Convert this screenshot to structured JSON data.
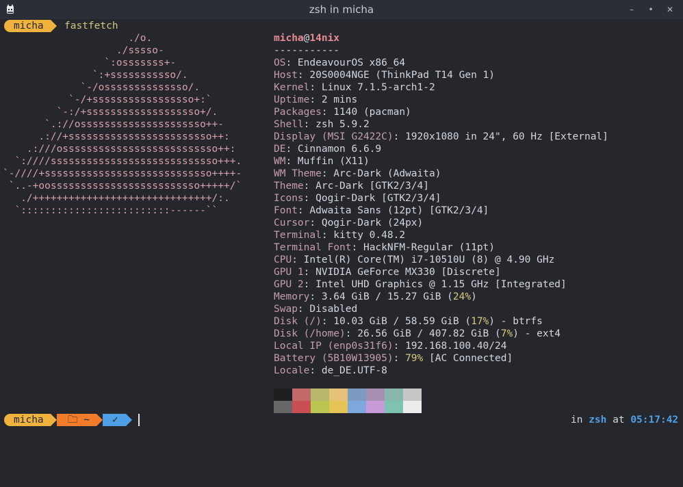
{
  "window": {
    "title": "zsh in micha",
    "minimize": "–",
    "maximize": "•",
    "close": "✕"
  },
  "prompt1": {
    "user": "micha",
    "command": "fastfetch"
  },
  "logo_lines": [
    "                     ./o.",
    "                   ./sssso-",
    "                 `:osssssss+-",
    "               `:+sssssssssso/.",
    "             `-/ossssssssssssso/.",
    "           `-/+sssssssssssssssso+:`",
    "         `-:/+sssssssssssssssssso+/.",
    "       `.://osssssssssssssssssssso++-",
    "      .://+ssssssssssssssssssssssso++:",
    "    .:///ossssssssssssssssssssssssso++:",
    "  `:////ssssssssssssssssssssssssssso+++.",
    "`-////+ssssssssssssssssssssssssssso++++-",
    " `..-+oosssssssssssssssssssssssso+++++/`",
    "   ./++++++++++++++++++++++++++++++/:.",
    "  `:::::::::::::::::::::::::------``"
  ],
  "header": {
    "user": "micha",
    "at": "@",
    "host": "14nix",
    "separator": "-----------"
  },
  "info": [
    {
      "label": "OS",
      "parts": [
        {
          "t": ": EndeavourOS x86_64"
        }
      ]
    },
    {
      "label": "Host",
      "parts": [
        {
          "t": ": 20S0004NGE (ThinkPad T14 Gen 1)"
        }
      ]
    },
    {
      "label": "Kernel",
      "parts": [
        {
          "t": ": Linux 7.1.5-arch1-2"
        }
      ]
    },
    {
      "label": "Uptime",
      "parts": [
        {
          "t": ": 2 mins"
        }
      ]
    },
    {
      "label": "Packages",
      "parts": [
        {
          "t": ": 1140 (pacman)"
        }
      ]
    },
    {
      "label": "Shell",
      "parts": [
        {
          "t": ": zsh 5.9.2"
        }
      ]
    },
    {
      "label": "Display (MSI G2422C)",
      "parts": [
        {
          "t": ": 1920x1080 in 24\", 60 Hz [External]"
        }
      ]
    },
    {
      "label": "DE",
      "parts": [
        {
          "t": ": Cinnamon 6.6.9"
        }
      ]
    },
    {
      "label": "WM",
      "parts": [
        {
          "t": ": Muffin (X11)"
        }
      ]
    },
    {
      "label": "WM Theme",
      "parts": [
        {
          "t": ": Arc-Dark (Adwaita)"
        }
      ]
    },
    {
      "label": "Theme",
      "parts": [
        {
          "t": ": Arc-Dark [GTK2/3/4]"
        }
      ]
    },
    {
      "label": "Icons",
      "parts": [
        {
          "t": ": Qogir-Dark [GTK2/3/4]"
        }
      ]
    },
    {
      "label": "Font",
      "parts": [
        {
          "t": ": Adwaita Sans (12pt) [GTK2/3/4]"
        }
      ]
    },
    {
      "label": "Cursor",
      "parts": [
        {
          "t": ": Qogir-Dark (24px)"
        }
      ]
    },
    {
      "label": "Terminal",
      "parts": [
        {
          "t": ": kitty 0.48.2"
        }
      ]
    },
    {
      "label": "Terminal Font",
      "parts": [
        {
          "t": ": HackNFM-Regular (11pt)"
        }
      ]
    },
    {
      "label": "CPU",
      "parts": [
        {
          "t": ": Intel(R) Core(TM) i7-10510U (8) @ 4.90 GHz"
        }
      ]
    },
    {
      "label": "GPU 1",
      "parts": [
        {
          "t": ": NVIDIA GeForce MX330 [Discrete]"
        }
      ]
    },
    {
      "label": "GPU 2",
      "parts": [
        {
          "t": ": Intel UHD Graphics @ 1.15 GHz [Integrated]"
        }
      ]
    },
    {
      "label": "Memory",
      "parts": [
        {
          "t": ": 3.64 GiB / 15.27 GiB ("
        },
        {
          "t": "24%",
          "pct": true
        },
        {
          "t": ")"
        }
      ]
    },
    {
      "label": "Swap",
      "parts": [
        {
          "t": ": Disabled"
        }
      ]
    },
    {
      "label": "Disk (/)",
      "parts": [
        {
          "t": ": 10.03 GiB / 58.59 GiB ("
        },
        {
          "t": "17%",
          "pct": true
        },
        {
          "t": ") - btrfs"
        }
      ]
    },
    {
      "label": "Disk (/home)",
      "parts": [
        {
          "t": ": 26.56 GiB / 407.82 GiB ("
        },
        {
          "t": "7%",
          "pct": true
        },
        {
          "t": ") - ext4"
        }
      ]
    },
    {
      "label": "Local IP (enp0s31f6)",
      "parts": [
        {
          "t": ": 192.168.100.40/24"
        }
      ]
    },
    {
      "label": "Battery (5B10W13905)",
      "parts": [
        {
          "t": ": "
        },
        {
          "t": "79%",
          "pct": true
        },
        {
          "t": " [AC Connected]"
        }
      ]
    },
    {
      "label": "Locale",
      "parts": [
        {
          "t": ": de_DE.UTF-8"
        }
      ]
    }
  ],
  "palette_top": [
    "#1d1f21",
    "#c26a6a",
    "#b8b86d",
    "#e6c17a",
    "#7d9ac0",
    "#a78fb2",
    "#88b8ad",
    "#c7c7c7"
  ],
  "palette_bottom": [
    "#676767",
    "#c84e53",
    "#b9c64f",
    "#e4c357",
    "#7ea7de",
    "#c79ad8",
    "#7cc3b2",
    "#ececec"
  ],
  "prompt2": {
    "user": "micha",
    "dir": "🗀 ~",
    "status": "✓",
    "right_in": "in ",
    "right_shell": "zsh",
    "right_at": " at ",
    "right_time": "05:17:42"
  },
  "colors": {
    "background": "#25272d",
    "titlebar": "#2b2e36",
    "accent_yellow": "#f0b13d",
    "accent_orange": "#f27c2a",
    "accent_blue": "#4f9fe7",
    "label": "#c79dac",
    "percent": "#d7cb7c"
  }
}
